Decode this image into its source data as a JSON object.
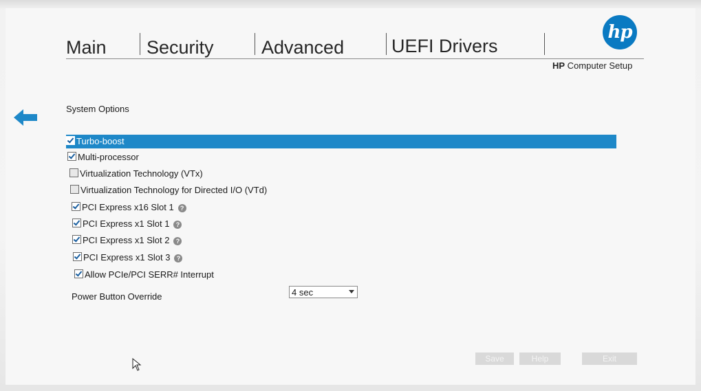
{
  "tabs": [
    {
      "label": "Main"
    },
    {
      "label": "Security"
    },
    {
      "label": "Advanced"
    },
    {
      "label": "UEFI Drivers"
    }
  ],
  "brand": {
    "logo_text": "hp",
    "subtitle_bold": "HP",
    "subtitle_rest": " Computer Setup",
    "accent_color": "#1e88c8"
  },
  "section": {
    "title": "System Options"
  },
  "options": [
    {
      "label": "Turbo-boost",
      "checked": true,
      "selected": true,
      "help": false
    },
    {
      "label": "Multi-processor",
      "checked": true,
      "selected": false,
      "help": false
    },
    {
      "label": "Virtualization Technology (VTx)",
      "checked": false,
      "selected": false,
      "help": false
    },
    {
      "label": "Virtualization Technology for Directed I/O (VTd)",
      "checked": false,
      "selected": false,
      "help": false
    },
    {
      "label": "PCI Express x16 Slot 1",
      "checked": true,
      "selected": false,
      "help": true
    },
    {
      "label": "PCI Express x1 Slot 1",
      "checked": true,
      "selected": false,
      "help": true
    },
    {
      "label": "PCI Express x1 Slot 2",
      "checked": true,
      "selected": false,
      "help": true
    },
    {
      "label": "PCI Express x1 Slot 3",
      "checked": true,
      "selected": false,
      "help": true
    },
    {
      "label": "Allow PCIe/PCI SERR# Interrupt",
      "checked": true,
      "selected": false,
      "help": false
    }
  ],
  "power_button_override": {
    "label": "Power Button Override",
    "value": "4 sec"
  },
  "buttons": {
    "save": "Save",
    "help": "Help",
    "exit": "Exit"
  },
  "icons": {
    "back": "arrow-left-icon",
    "help": "question-circle-icon",
    "cursor": "mouse-pointer-icon"
  }
}
